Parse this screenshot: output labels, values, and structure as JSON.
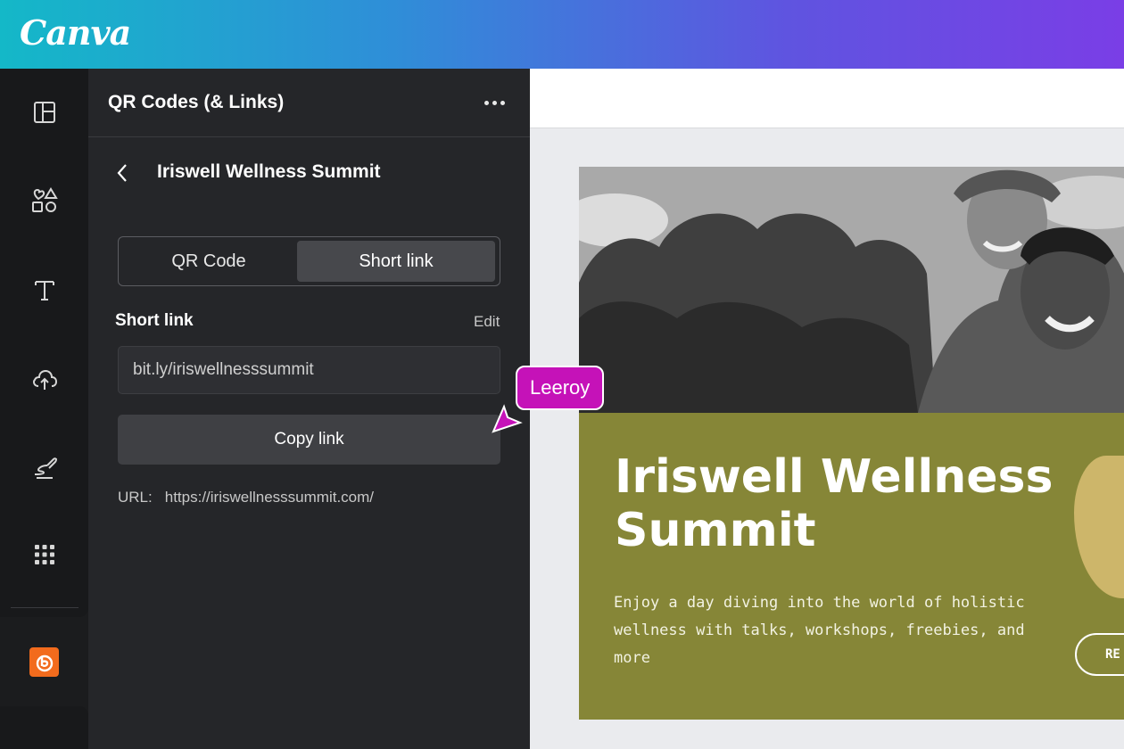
{
  "app": {
    "logo": "Canva"
  },
  "rail": {
    "items": [
      {
        "icon": "layout-icon"
      },
      {
        "icon": "elements-icon"
      },
      {
        "icon": "text-icon"
      },
      {
        "icon": "upload-icon"
      },
      {
        "icon": "draw-icon"
      },
      {
        "icon": "apps-grid-icon"
      }
    ],
    "active_app_icon": "bitly-icon"
  },
  "panel": {
    "title": "QR Codes (& Links)",
    "subtitle": "Iriswell Wellness Summit",
    "tabs": {
      "qr": "QR Code",
      "short": "Short link",
      "selected": "Short link"
    },
    "short_link_label": "Short link",
    "edit_label": "Edit",
    "short_link_value": "bit.ly/iriswellnesssummit",
    "copy_button": "Copy link",
    "url_label": "URL:",
    "url_value": "https://iriswellnesssummit.com/"
  },
  "design": {
    "title": "Iriswell Wellness Summit",
    "body": "Enjoy a day diving into the world of holistic wellness with talks, workshops, freebies, and more",
    "register_button": "RE",
    "accent_color": "#868637"
  },
  "collaborator": {
    "name": "Leeroy",
    "color": "#c512b8"
  }
}
